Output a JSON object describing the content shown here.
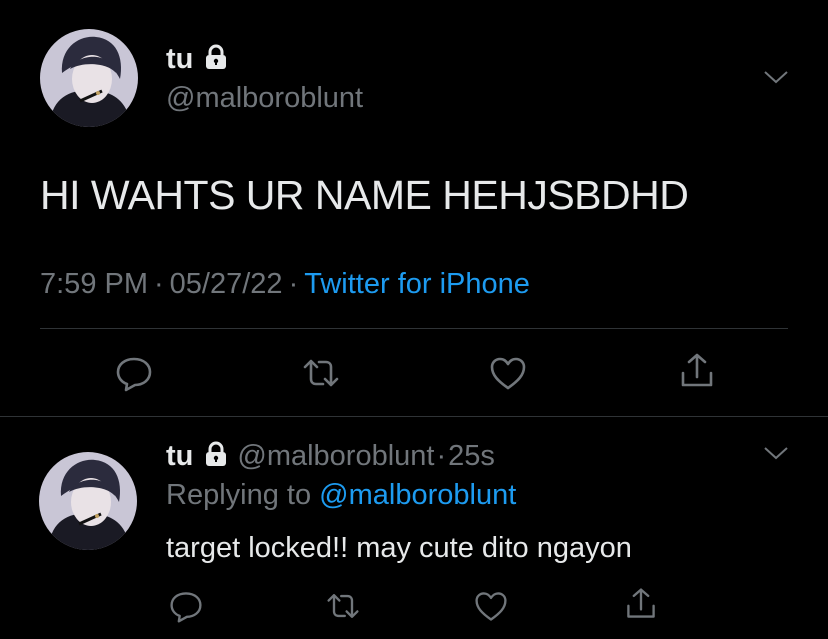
{
  "main_tweet": {
    "display_name": "tu",
    "handle": "@malboroblunt",
    "text": "HI WAHTS UR NAME HEHJSBDHD",
    "time": "7:59 PM",
    "date": "05/27/22",
    "source": "Twitter for iPhone",
    "separator": "·"
  },
  "reply_tweet": {
    "display_name": "tu",
    "handle": "@malboroblunt",
    "separator": "·",
    "age": "25s",
    "replying_prefix": "Replying to",
    "replying_to": "@malboroblunt",
    "text": "target locked!! may cute dito ngayon"
  },
  "colors": {
    "background": "#000000",
    "primary_text": "#e7e9ea",
    "secondary_text": "#71767b",
    "link": "#1d9bf0",
    "divider": "#2f3336"
  },
  "icons": [
    "lock-icon",
    "chevron-down-icon",
    "reply-icon",
    "retweet-icon",
    "like-icon",
    "share-icon"
  ]
}
